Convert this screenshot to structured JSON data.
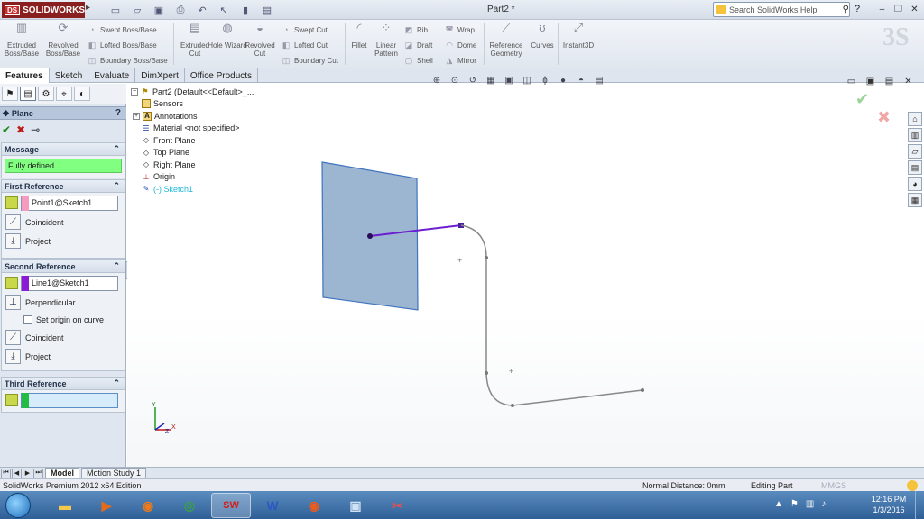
{
  "app": {
    "logo_text": "SOLIDWORKS",
    "logo_mark": "DS",
    "document_title": "Part2 *",
    "help_search_placeholder": "Search SolidWorks Help",
    "help_label": "?"
  },
  "command_manager": {
    "extruded_boss": "Extruded Boss/Base",
    "revolved_boss": "Revolved Boss/Base",
    "swept_boss": "Swept Boss/Base",
    "lofted_boss": "Lofted Boss/Base",
    "boundary_boss": "Boundary Boss/Base",
    "extruded_cut": "Extruded Cut",
    "hole_wizard": "Hole Wizard",
    "revolved_cut": "Revolved Cut",
    "swept_cut": "Swept Cut",
    "lofted_cut": "Lofted Cut",
    "boundary_cut": "Boundary Cut",
    "fillet": "Fillet",
    "linear_pattern": "Linear Pattern",
    "rib": "Rib",
    "draft": "Draft",
    "shell": "Shell",
    "wrap": "Wrap",
    "dome": "Dome",
    "mirror": "Mirror",
    "reference_geometry": "Reference Geometry",
    "curves": "Curves",
    "instant3d": "Instant3D"
  },
  "tabs": [
    "Features",
    "Sketch",
    "Evaluate",
    "DimXpert",
    "Office Products"
  ],
  "property_manager": {
    "title": "Plane",
    "help": "?",
    "message_header": "Message",
    "message": "Fully defined",
    "first_reference": {
      "header": "First Reference",
      "entity": "Point1@Sketch1",
      "swatch_color": "#f79ac0",
      "options": [
        "Coincident",
        "Project"
      ]
    },
    "second_reference": {
      "header": "Second Reference",
      "entity": "Line1@Sketch1",
      "swatch_color": "#8a1ad6",
      "options": [
        "Perpendicular",
        "Set origin on curve",
        "Coincident",
        "Project"
      ]
    },
    "third_reference": {
      "header": "Third Reference",
      "entity": "",
      "swatch_color": "#22bb44"
    }
  },
  "feature_tree": {
    "root": "Part2  (Default<<Default>_...",
    "items": [
      "Sensors",
      "Annotations",
      "Material <not specified>",
      "Front Plane",
      "Top Plane",
      "Right Plane",
      "Origin",
      "(-) Sketch1"
    ]
  },
  "model_tabs": [
    "Model",
    "Motion Study 1"
  ],
  "status": {
    "edition": "SolidWorks Premium 2012 x64 Edition",
    "distance": "Normal Distance: 0mm",
    "mode": "Editing Part",
    "units": "MMGS"
  },
  "taskbar": {
    "time": "12:16 PM",
    "date": "1/3/2016"
  },
  "colors": {
    "plane_fill": "#8ba8c9",
    "plane_stroke": "#3f74c0",
    "line_color": "#6a1fd0",
    "curve_color": "#888888",
    "message_bg": "#80ff80"
  }
}
